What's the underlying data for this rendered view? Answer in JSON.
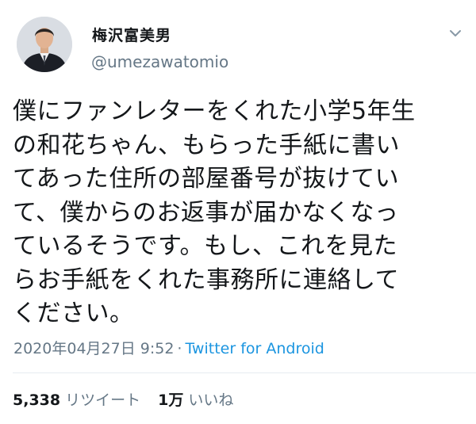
{
  "user": {
    "display_name": "梅沢富美男",
    "handle": "@umezawatomio"
  },
  "icons": {
    "menu": "chevron-down-icon"
  },
  "tweet": {
    "text": "僕にファンレターをくれた小学5年生\nの和花ちゃん、もらった手紙に書い\nてあった住所の部屋番号が抜けてい\nて、僕からのお返事が届かなくなっ\nているそうです。もし、これを見た\nらお手紙をくれた事務所に連絡して\nください。",
    "timestamp": "2020年04月27日 9:52",
    "separator": "·",
    "source": "Twitter for Android"
  },
  "stats": {
    "retweets_count": "5,338",
    "retweets_label": "リツイート",
    "likes_count": "1万",
    "likes_label": "いいね"
  },
  "colors": {
    "text": "#14171a",
    "secondary": "#657786",
    "link": "#1b95e0",
    "divider": "#e6ecf0"
  }
}
